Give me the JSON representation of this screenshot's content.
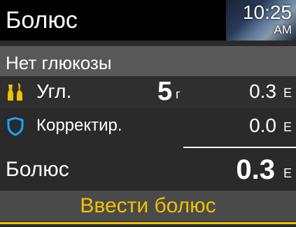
{
  "header": {
    "title": "Болюс",
    "time": "10:25",
    "ampm": "AM"
  },
  "glucose": {
    "text": "Нет глюкозы"
  },
  "carbs": {
    "icon": "carbs-icon",
    "label": "Угл.",
    "value": "5",
    "value_unit": "г",
    "insulin": "0.3",
    "insulin_unit": "Е"
  },
  "correction": {
    "icon": "shield-icon",
    "label": "Корректир.",
    "insulin": "0.0",
    "insulin_unit": "Е"
  },
  "bolus": {
    "label": "Болюс",
    "value": "0.3",
    "unit": "Е"
  },
  "action": {
    "label": "Ввести болюс"
  },
  "colors": {
    "accent": "#f2c200",
    "correction_icon": "#1aa3ff",
    "selected_row": "#585858"
  }
}
